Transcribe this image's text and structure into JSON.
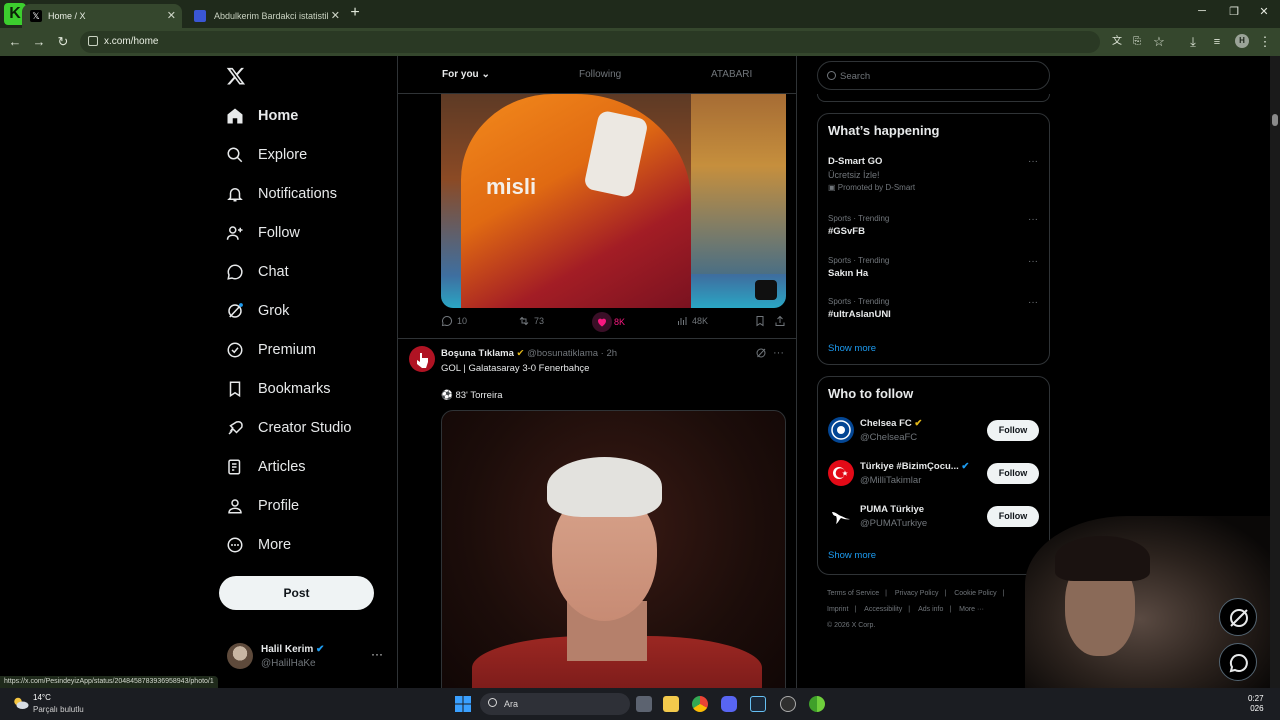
{
  "browser": {
    "tabs": [
      {
        "title": "Home / X",
        "active": true
      },
      {
        "title": "Abdulkerim Bardakci istatistikle",
        "active": false
      }
    ],
    "app_badge": "6",
    "url": "x.com/home",
    "profile_initial": "H",
    "status_url": "https://x.com/PesindeyizApp/status/2048458783936958943/photo/1"
  },
  "nav": {
    "items": [
      {
        "label": "Home",
        "icon": "home-icon"
      },
      {
        "label": "Explore",
        "icon": "search-icon"
      },
      {
        "label": "Notifications",
        "icon": "bell-icon"
      },
      {
        "label": "Follow",
        "icon": "person-plus-icon"
      },
      {
        "label": "Chat",
        "icon": "chat-icon"
      },
      {
        "label": "Grok",
        "icon": "grok-icon"
      },
      {
        "label": "Premium",
        "icon": "premium-icon"
      },
      {
        "label": "Bookmarks",
        "icon": "bookmark-icon"
      },
      {
        "label": "Creator Studio",
        "icon": "rocket-icon"
      },
      {
        "label": "Articles",
        "icon": "article-icon"
      },
      {
        "label": "Profile",
        "icon": "person-icon"
      },
      {
        "label": "More",
        "icon": "more-circle-icon"
      }
    ],
    "post_label": "Post",
    "account": {
      "name": "Halil Kerim",
      "handle": "@HalilHaKe"
    }
  },
  "feed": {
    "tabs": [
      "For you",
      "Following",
      "ATABARI"
    ],
    "post1": {
      "replies": "10",
      "reposts": "73",
      "likes": "8K",
      "views": "48K",
      "image_text": "misli"
    },
    "post2": {
      "author": "Boşuna Tıklama",
      "handle": "@bosunatiklama",
      "time": "· 2h",
      "line1": "GOL | Galatasaray 3-0 Fenerbahçe",
      "line2": "⚽ 83' Torreira"
    }
  },
  "search": {
    "placeholder": "Search"
  },
  "whats_happening": {
    "title": "What’s happening",
    "items": [
      {
        "category": "",
        "name": "D-Smart GO",
        "sub": "Ücretsiz İzle!",
        "promo": "Promoted by D-Smart"
      },
      {
        "category": "Sports · Trending",
        "name": "#GSvFB"
      },
      {
        "category": "Sports · Trending",
        "name": "Sakın Ha"
      },
      {
        "category": "Sports · Trending",
        "name": "#ultrAslanUNI"
      }
    ],
    "show_more": "Show more"
  },
  "who_to_follow": {
    "title": "Who to follow",
    "accounts": [
      {
        "name": "Chelsea FC",
        "handle": "@ChelseaFC",
        "button": "Follow",
        "color": "#034694"
      },
      {
        "name": "Türkiye #BizimÇocu...",
        "handle": "@MilliTakimlar",
        "button": "Follow",
        "color": "#e30a17"
      },
      {
        "name": "PUMA Türkiye",
        "handle": "@PUMATurkiye",
        "button": "Follow",
        "color": "#000000"
      }
    ],
    "show_more": "Show more"
  },
  "footer": {
    "links": [
      "Terms of Service",
      "Privacy Policy",
      "Cookie Policy",
      "Imprint",
      "Accessibility",
      "Ads info",
      "More ···"
    ],
    "copyright": "© 2026 X Corp."
  },
  "taskbar": {
    "weather_temp": "14°C",
    "weather_desc": "Parçalı bulutlu",
    "search_label": "Ara",
    "time": "0:27",
    "date": "026"
  },
  "colors": {
    "accent": "#1d9bf0",
    "like": "#f91880",
    "chrome": "#35472d",
    "verified": "#1d9bf0",
    "gold": "#e2b719"
  }
}
